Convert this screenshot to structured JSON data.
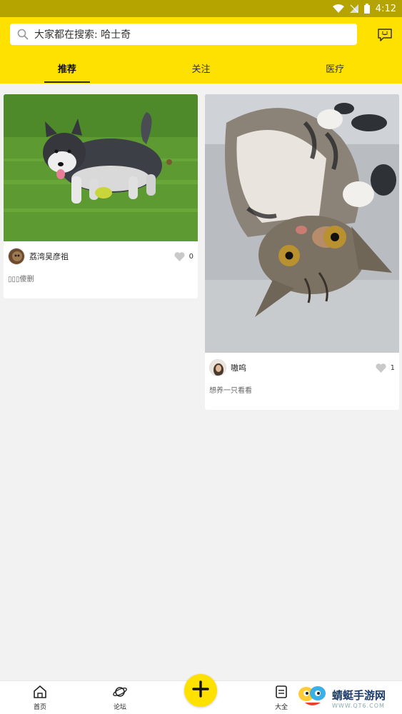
{
  "status_bar": {
    "time": "4:12",
    "icons": [
      "wifi-icon",
      "signal-off-icon",
      "battery-icon"
    ]
  },
  "search": {
    "text": "大家都在搜索: 哈士奇",
    "icon": "search-icon"
  },
  "header": {
    "message_icon": "chat-bubble-icon",
    "accent_color": "#ffe100"
  },
  "tabs": [
    {
      "label": "推荐",
      "active": true
    },
    {
      "label": "关注",
      "active": false
    },
    {
      "label": "医疗",
      "active": false
    }
  ],
  "feed": [
    {
      "author": "荔湾吴彦祖",
      "likes": "0",
      "description": "▯▯▯傻删",
      "photo": "husky-puppy-on-grass"
    },
    {
      "author": "嗷呜",
      "likes": "1",
      "description": "想养一只看看",
      "photo": "tabby-cat-lying-on-bed"
    }
  ],
  "bottom_nav": [
    {
      "label": "首页",
      "icon": "home-icon"
    },
    {
      "label": "论坛",
      "icon": "planet-icon"
    },
    {
      "label": "大全",
      "icon": "book-icon"
    }
  ],
  "fab_icon": "plus-icon",
  "watermark": {
    "text": "蜻蜓手游网",
    "url": "WWW.QT6.COM"
  }
}
